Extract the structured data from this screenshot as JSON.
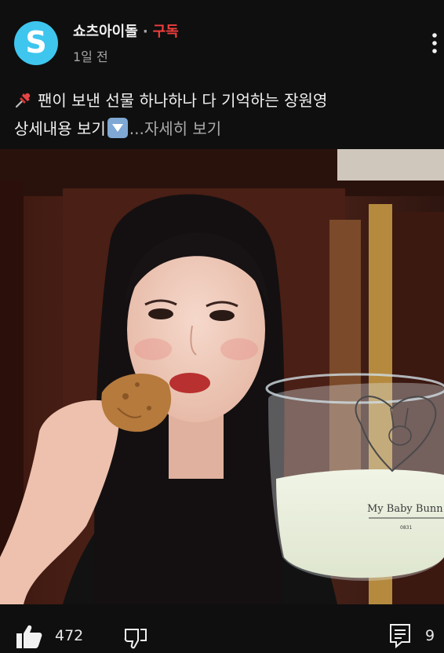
{
  "channel": {
    "name": "쇼츠아이돌",
    "separator": "·",
    "subscribe_label": "구독",
    "posted_time": "1일 전",
    "avatar_letter": "S",
    "avatar_color": "#3ec6ee"
  },
  "post": {
    "title_line": "팬이 보낸 선물 하나하나 다 기억하는 장원영",
    "detail_line": "상세내용 보기",
    "more_label": "...자세히 보기",
    "pin_icon": "pushpin-icon",
    "down_icon": "down-arrow-box-icon"
  },
  "media": {
    "mug_text": "My Baby Bunn",
    "mug_small_text": "0831"
  },
  "actions": {
    "like_count": "472",
    "comment_count": "9",
    "like_icon": "thumbs-up-icon",
    "dislike_icon": "thumbs-down-icon",
    "comment_icon": "comment-icon"
  },
  "colors": {
    "background": "#0f0f0f",
    "subscribe": "#f03e3e",
    "secondary_text": "#a5a5a5"
  }
}
